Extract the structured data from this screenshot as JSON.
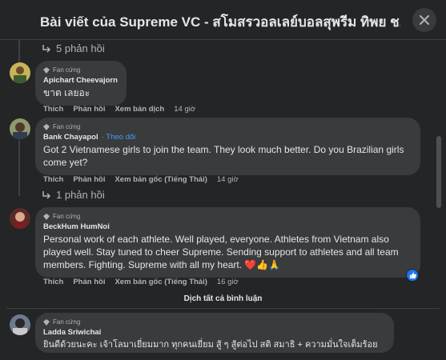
{
  "header": {
    "title": "Bài viết của Supreme VC - สโมสรวอลเลย์บอลสุพรีม ทิพย ช..."
  },
  "replies_top": {
    "label": "5 phản hồi"
  },
  "comments": [
    {
      "badge": "Fan cứng",
      "author": "Apichart Cheevajorn",
      "text": "ขาด เลยอะ",
      "actions": {
        "like": "Thích",
        "reply": "Phản hồi",
        "translate": "Xem bản dịch",
        "time": "14 giờ"
      }
    },
    {
      "badge": "Fan cứng",
      "author": "Bank Chayapol",
      "follow": "· Theo dõi",
      "text": "Got 2 Vietnamese girls to join the team. They look much better. Do you Brazilian girls come yet?",
      "actions": {
        "like": "Thích",
        "reply": "Phản hồi",
        "translate": "Xem bản gốc (Tiếng Thái)",
        "time": "14 giờ"
      },
      "replies": "1 phản hồi"
    },
    {
      "badge": "Fan cứng",
      "author": "BeckHum HumNoi",
      "text": "Personal work of each athlete. Well played, everyone. Athletes from Vietnam also played well. Stay tuned to cheer Supreme. Sending support to athletes and all team members. Fighting. Supreme with all my heart. ❤️👍🙏",
      "actions": {
        "like": "Thích",
        "reply": "Phản hồi",
        "translate": "Xem bản gốc (Tiếng Thái)",
        "time": "16 giờ"
      }
    },
    {
      "badge": "Fan cứng",
      "author": "Ladda Sriwichai",
      "text": "ยินดีด้วยนะคะ เจ้าโลมาเยี่ยมมาก ทุกคนเยี่ยม สู้ ๆ สู้ต่อไป สติ สมาธิ + ความมั่นใจเต็มร้อย"
    }
  ],
  "view_all": "Dịch tất cả bình luận",
  "colors": {
    "bg": "#242526",
    "bubble": "#3a3b3c",
    "link": "#4599ff",
    "like": "#1877f2"
  }
}
